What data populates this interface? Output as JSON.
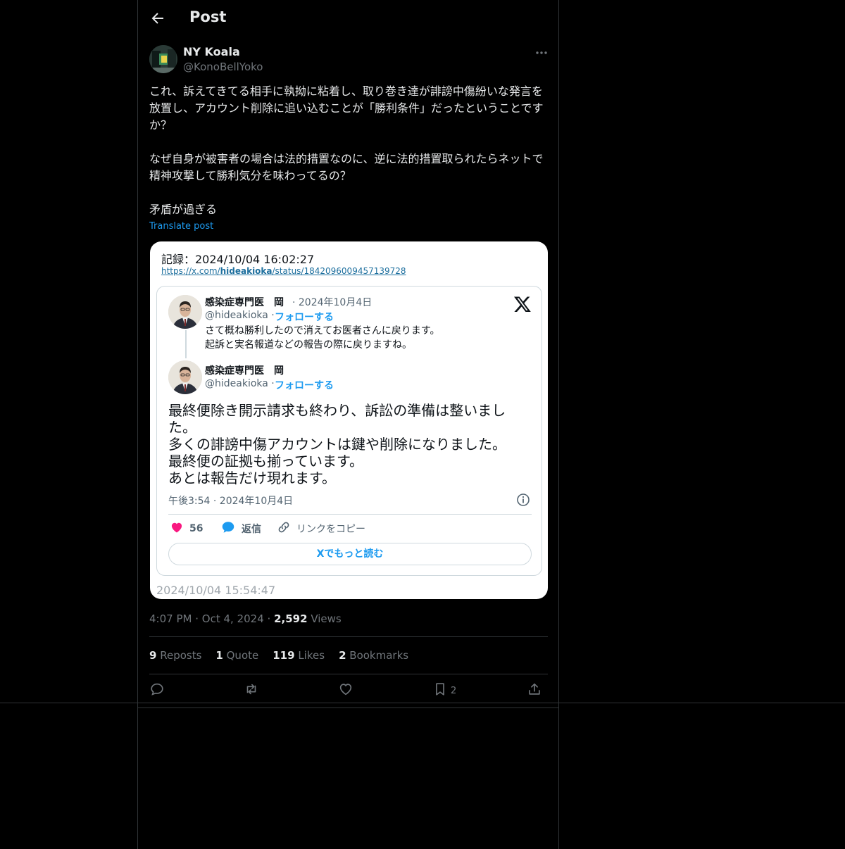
{
  "header": {
    "title": "Post"
  },
  "author": {
    "name": "NY Koala",
    "handle": "@KonoBellYoko"
  },
  "post": {
    "paragraphs": [
      "これ、訴えてきてる相手に執拗に粘着し、取り巻き達が誹謗中傷紛いな発言を放置し、アカウント削除に追い込むことが「勝利条件」だったということですか？",
      "なぜ自身が被害者の場合は法的措置なのに、逆に法的措置取られたらネットで精神攻撃して勝利気分を味わってるの？",
      "矛盾が過ぎる"
    ],
    "translate_label": "Translate post"
  },
  "card": {
    "record_label": "記録：2024/10/04 16:02:27",
    "url_prefix": "https://x.com/",
    "url_bold": "hideakioka",
    "url_suffix": "/status/1842096009457139728",
    "footer_timestamp": "2024/10/04 15:54:47",
    "embed": {
      "name": "感染症専門医　岡",
      "date": "· 2024年10月4日",
      "handle": "@hideakioka ·",
      "follow": "フォローする",
      "reply_lines": [
        "さて概ね勝利したので消えてお医者さんに戻ります。",
        "起訴と実名報道などの報告の際に戻りますね。"
      ],
      "main_lines": [
        "最終便除き開示請求も終わり、訴訟の準備は整いまし",
        "た。",
        "多くの誹謗中傷アカウントは鍵や削除になりました。",
        "最終便の証拠も揃っています。",
        "あとは報告だけ現れます。"
      ],
      "time": "午後3:54 · 2024年10月4日",
      "likes": "56",
      "reply_label": "返信",
      "copy_link_label": "リンクをコピー",
      "read_more": "Xでもっと読む"
    }
  },
  "meta": {
    "time": "4:07 PM",
    "date": "Oct 4, 2024",
    "views_count": "2,592",
    "views_label": "Views"
  },
  "stats": [
    {
      "count": "9",
      "label": "Reposts"
    },
    {
      "count": "1",
      "label": "Quote"
    },
    {
      "count": "119",
      "label": "Likes"
    },
    {
      "count": "2",
      "label": "Bookmarks"
    }
  ],
  "actions": {
    "bookmark_count": "2"
  },
  "colors": {
    "accent": "#1d9bf0",
    "like": "#f91880",
    "background": "#000000"
  }
}
